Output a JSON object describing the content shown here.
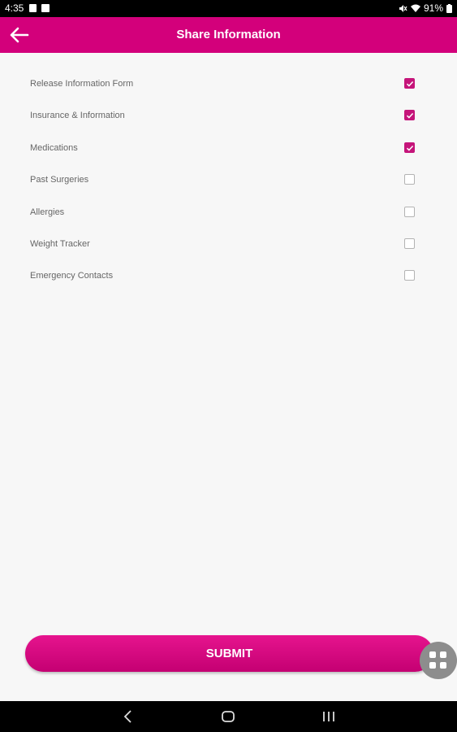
{
  "status": {
    "time": "4:35",
    "battery": "91%"
  },
  "header": {
    "title": "Share Information"
  },
  "items": [
    {
      "label": "Release Information Form",
      "checked": true
    },
    {
      "label": "Insurance & Information",
      "checked": true
    },
    {
      "label": "Medications",
      "checked": true
    },
    {
      "label": "Past Surgeries",
      "checked": false
    },
    {
      "label": "Allergies",
      "checked": false
    },
    {
      "label": "Weight Tracker",
      "checked": false
    },
    {
      "label": "Emergency Contacts",
      "checked": false
    }
  ],
  "submit": {
    "label": "SUBMIT"
  },
  "colors": {
    "accent": "#d3007b",
    "checkbox": "#c5157a"
  },
  "icons": {
    "back": "arrow-left-icon",
    "fab": "grid-icon",
    "nav": [
      "back-nav-icon",
      "home-nav-icon",
      "recents-nav-icon"
    ]
  }
}
